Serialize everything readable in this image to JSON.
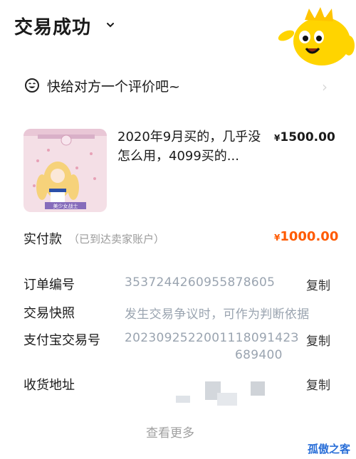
{
  "header": {
    "title": "交易成功"
  },
  "review": {
    "prompt": "快给对方一个评价吧~"
  },
  "product": {
    "title": "2020年9月买的，几乎没怎么用，4099买的...",
    "price": "1500.00",
    "currency": "¥",
    "thumb_caption": "美少女战士"
  },
  "payment": {
    "label": "实付款",
    "sub": "（已到达卖家账户）",
    "value": "1000.00",
    "currency": "¥",
    "accent_color": "#ff5a00"
  },
  "details": {
    "order_label": "订单编号",
    "order_value": "3537244260955878605",
    "snapshot_label": "交易快照",
    "snapshot_value": "发生交易争议时，可作为判断依据",
    "alipay_label": "支付宝交易号",
    "alipay_value_1": "202309252200111809142З",
    "alipay_value_2": "689400",
    "address_label": "收货地址",
    "copy": "复制"
  },
  "footer": {
    "more": "查看更多"
  },
  "watermark": {
    "text": "孤傲之客"
  }
}
